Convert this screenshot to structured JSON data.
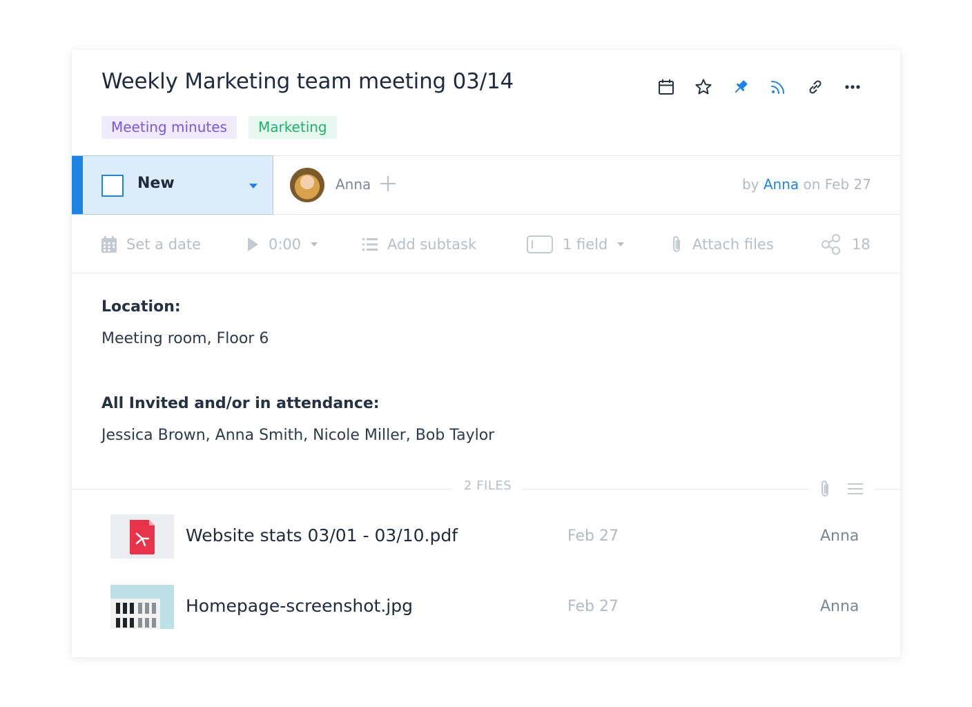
{
  "task": {
    "title": "Weekly Marketing team meeting 03/14",
    "tags": [
      {
        "label": "Meeting minutes",
        "color": "#7a55e6",
        "bg": "#efebfd"
      },
      {
        "label": "Marketing",
        "color": "#1fb16b",
        "bg": "#e6f8ef"
      }
    ],
    "header_icons": [
      "calendar-icon",
      "star-icon",
      "pin-icon",
      "rss-icon",
      "link-icon",
      "more-icon"
    ]
  },
  "status": {
    "label": "New",
    "accent": "#1d84e6"
  },
  "assignee": {
    "name": "Anna"
  },
  "byline": {
    "by": "by",
    "author": "Anna",
    "on": "on Feb 27"
  },
  "toolbar": {
    "date": "Set a date",
    "timer": "0:00",
    "subtask": "Add subtask",
    "field": "1 field",
    "attach": "Attach files",
    "share_count": "18"
  },
  "body": {
    "location_label": "Location:",
    "location_value": "Meeting room, Floor 6",
    "attendance_label": "All Invited and/or in attendance:",
    "attendance_value": "Jessica Brown, Anna Smith, Nicole Miller, Bob Taylor"
  },
  "files": {
    "count_label": "2 FILES",
    "items": [
      {
        "name": "Website stats 03/01 - 03/10.pdf",
        "date": "Feb 27",
        "owner": "Anna",
        "type": "pdf"
      },
      {
        "name": "Homepage-screenshot.jpg",
        "date": "Feb 27",
        "owner": "Anna",
        "type": "image"
      }
    ]
  }
}
